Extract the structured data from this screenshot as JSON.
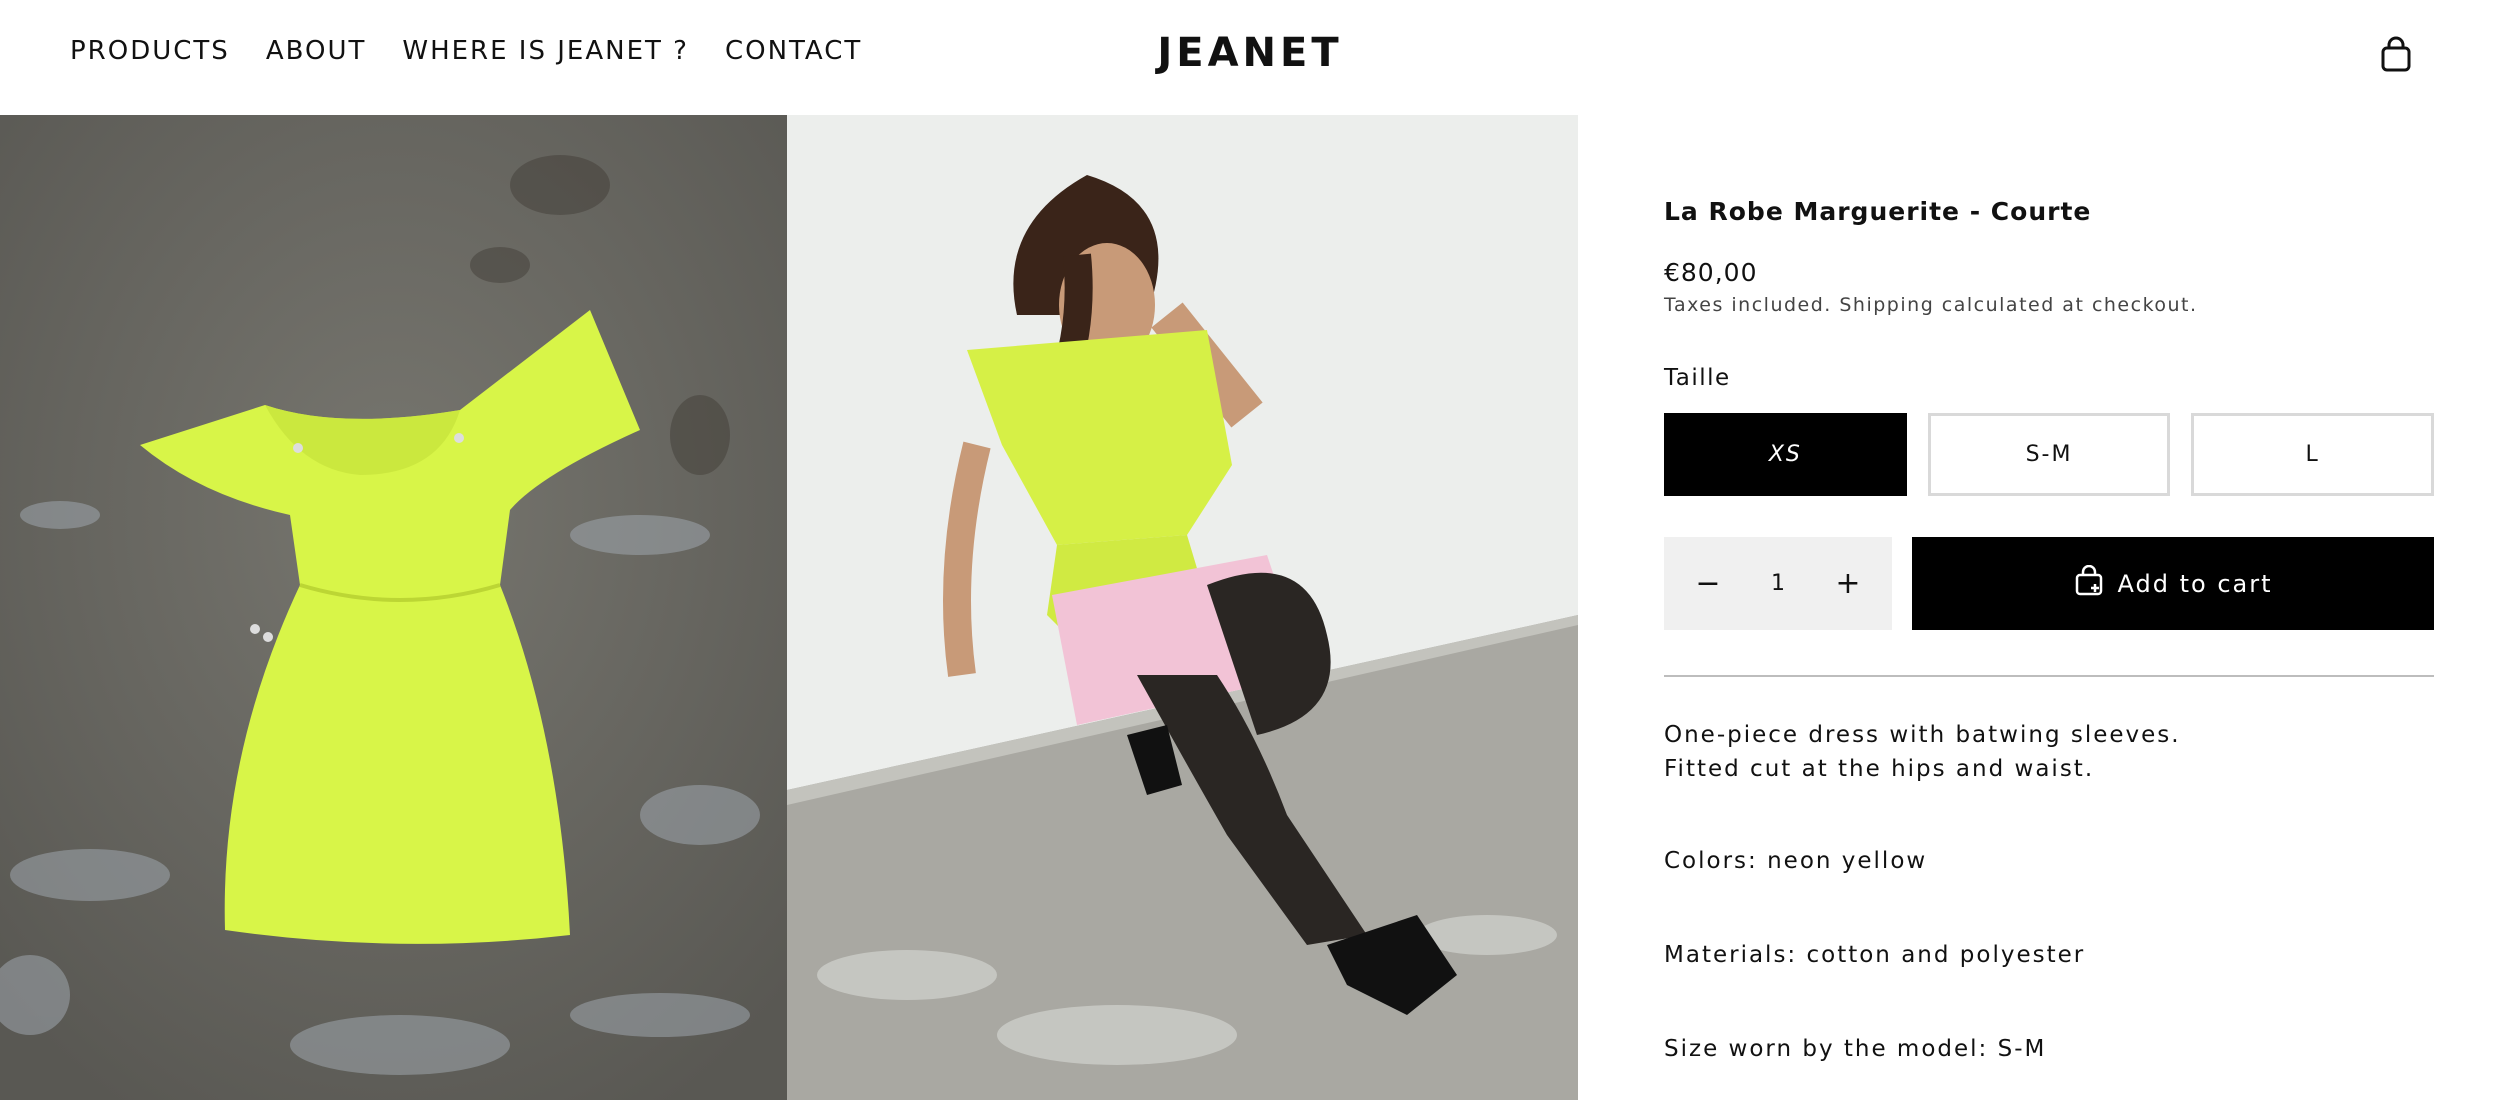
{
  "header": {
    "nav": [
      "PRODUCTS",
      "ABOUT",
      "WHERE IS JEANET ?",
      "CONTACT"
    ],
    "logo": "JEANET",
    "cart_icon": "shopping-bag-icon"
  },
  "gallery": {
    "images": [
      "neon-yellow-dress-flat-lay",
      "model-wearing-dress-sitting"
    ]
  },
  "product": {
    "title": "La Robe Marguerite - Courte",
    "price": "€80,00",
    "tax_note": "Taxes included. Shipping calculated at checkout.",
    "size_label": "Taille",
    "sizes": [
      {
        "label": "XS",
        "selected": true
      },
      {
        "label": "S-M",
        "selected": false
      },
      {
        "label": "L",
        "selected": false
      }
    ],
    "quantity": {
      "minus": "−",
      "value": "1",
      "plus": "+"
    },
    "add_to_cart": "Add to cart",
    "description": {
      "line1": "One-piece dress with batwing sleeves.",
      "line2": "Fitted cut at the hips and waist.",
      "colors": "Colors: neon yellow",
      "materials": "Materials: cotton and polyester",
      "size_worn": "Size worn by the model: S-M"
    }
  },
  "colors": {
    "accent": "#000000",
    "neon": "#d4f53f",
    "pink": "#f4c6d8"
  }
}
